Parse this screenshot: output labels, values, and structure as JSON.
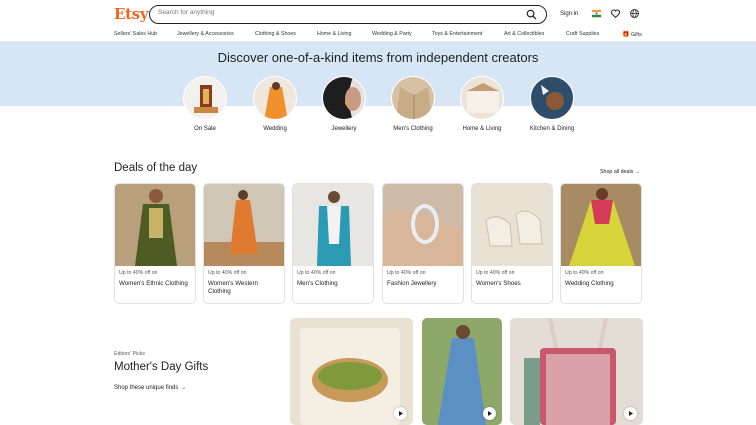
{
  "header": {
    "logo": "Etsy",
    "search_placeholder": "Search for anything",
    "sign_in": "Sign in"
  },
  "nav": [
    "Sellers' Sales Hub",
    "Jewellery & Accessories",
    "Clothing & Shoes",
    "Home & Living",
    "Wedding & Party",
    "Toys & Entertainment",
    "Art & Collectibles",
    "Craft Supplies",
    "Gifts"
  ],
  "banner": {
    "tagline": "Discover one-of-a-kind items from independent creators"
  },
  "categories": [
    {
      "label": "On Sale"
    },
    {
      "label": "Wedding"
    },
    {
      "label": "Jewellery"
    },
    {
      "label": "Men's Clothing"
    },
    {
      "label": "Home & Living"
    },
    {
      "label": "Kitchen & Dining"
    }
  ],
  "deals": {
    "title": "Deals of the day",
    "shop_all": "Shop all deals",
    "cards": [
      {
        "offer": "Up to 40% off on",
        "name": "Women's Ethnic Clothing"
      },
      {
        "offer": "Up to 40% off on",
        "name": "Women's Western Clothing"
      },
      {
        "offer": "Up to 40% off on",
        "name": "Men's Clothing"
      },
      {
        "offer": "Up to 40% off on",
        "name": "Fashion Jewellery"
      },
      {
        "offer": "Up to 40% off on",
        "name": "Women's Shoes"
      },
      {
        "offer": "Up to 40% off on",
        "name": "Wedding Clothing"
      }
    ]
  },
  "editors": {
    "eyebrow": "Editors' Picks",
    "title": "Mother's Day Gifts",
    "link": "Shop these unique finds"
  },
  "colors": {
    "brand": "#f1641e",
    "banner": "#d7e6f5"
  }
}
